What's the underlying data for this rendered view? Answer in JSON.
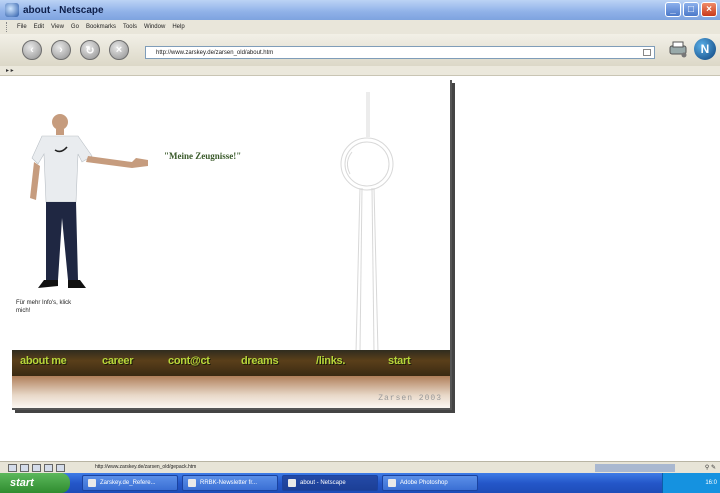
{
  "window": {
    "title": "about - Netscape"
  },
  "menu": [
    "File",
    "Edit",
    "View",
    "Go",
    "Bookmarks",
    "Tools",
    "Window",
    "Help"
  ],
  "address": {
    "url": "http://www.zarskey.de/zarsen_old/about.htm"
  },
  "page": {
    "quote": "\"Meine Zeugnisse!\"",
    "info_text": "Für mehr Info's, klick mich!",
    "nav": [
      "about me",
      "career",
      "cont@ct",
      "dreams",
      "/links.",
      "start"
    ],
    "copyright": "Zarsen 2003"
  },
  "status": {
    "text": "http://www.zarskey.de/zarsen_old/gepack.htm"
  },
  "taskbar": {
    "start_label": "start",
    "tasks": [
      "Zarskey.de_Refere...",
      "RRBK-Newsletter fr...",
      "about - Netscape",
      "Adobe Photoshop"
    ],
    "clock": "16:0"
  },
  "colors": {
    "nav_link": "#b8d63a",
    "quote": "#3a5a2a",
    "nav_bg": "#3a2a12"
  }
}
